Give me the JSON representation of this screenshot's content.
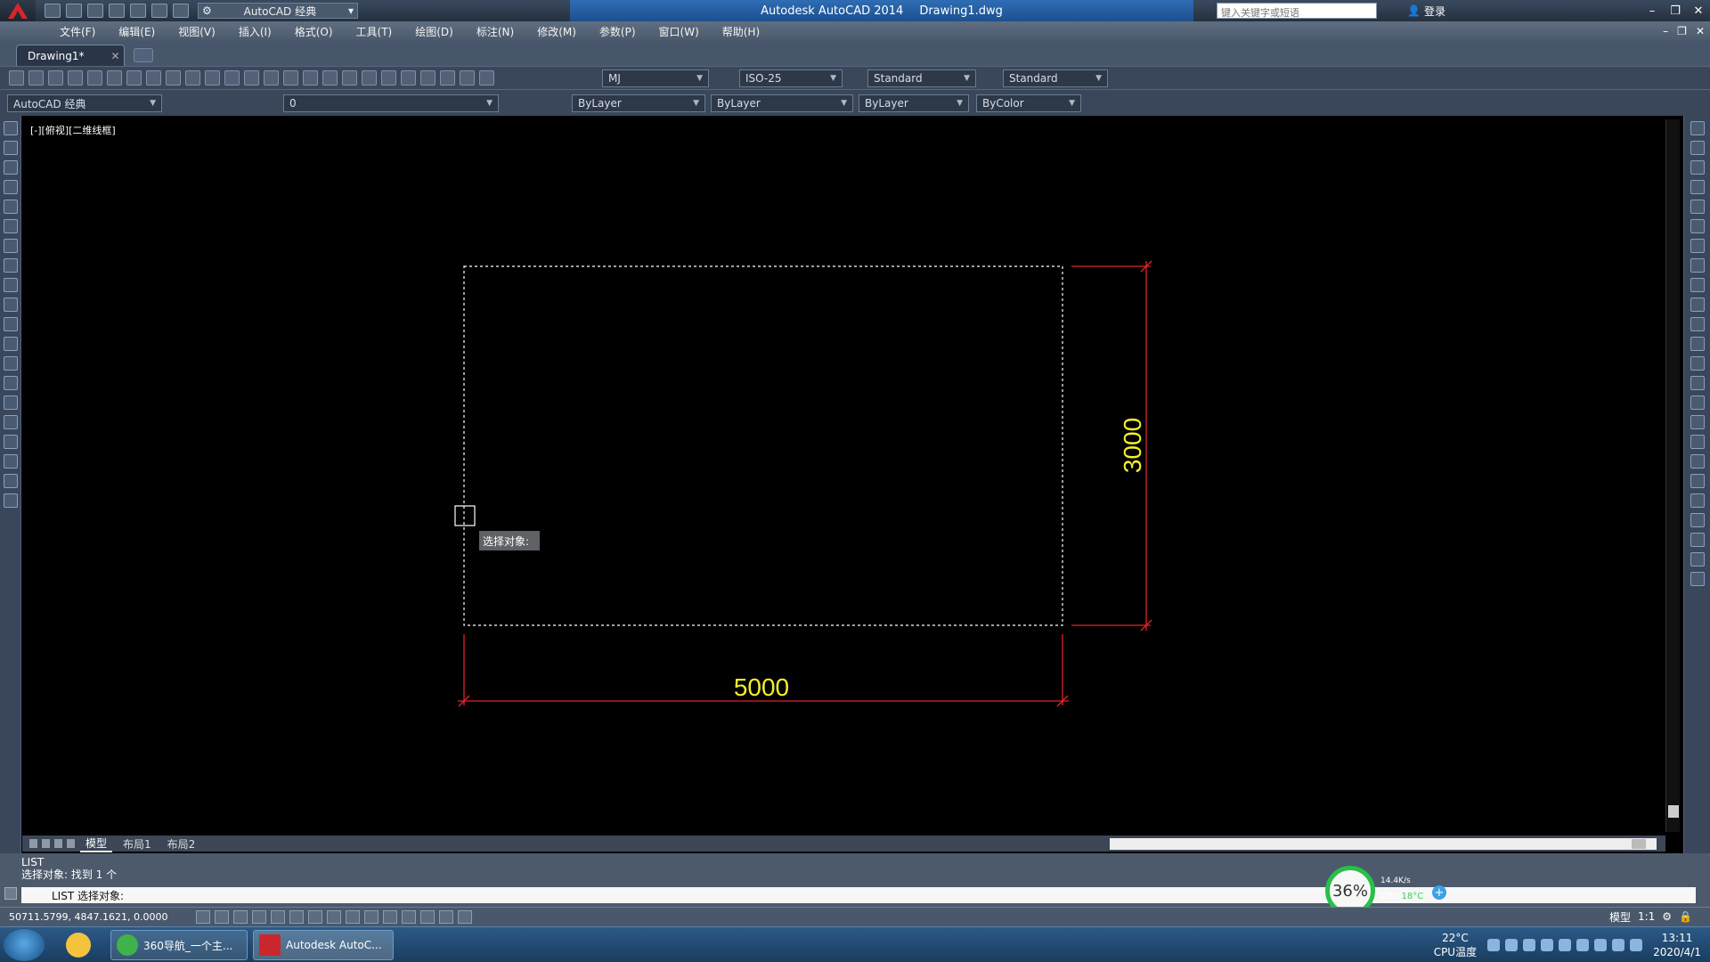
{
  "titlebar": {
    "workspace": "AutoCAD 经典",
    "app_title": "Autodesk AutoCAD 2014",
    "file_title": "Drawing1.dwg",
    "search_placeholder": "键入关键字或短语",
    "login_label": "登录"
  },
  "menubar": {
    "items": [
      "文件(F)",
      "编辑(E)",
      "视图(V)",
      "插入(I)",
      "格式(O)",
      "工具(T)",
      "绘图(D)",
      "标注(N)",
      "修改(M)",
      "参数(P)",
      "窗口(W)",
      "帮助(H)"
    ]
  },
  "tabs": {
    "document": "Drawing1*"
  },
  "toolbar": {
    "text_style": "MJ",
    "dim_style": "ISO-25",
    "table_style": "Standard",
    "multileader_style": "Standard",
    "workspace": "AutoCAD 经典",
    "layer": "0",
    "color": "ByLayer",
    "linetype": "ByLayer",
    "lineweight": "ByLayer",
    "plotstyle": "ByColor"
  },
  "viewport": {
    "label": "[-][俯视][二维线框]",
    "tooltip": "选择对象:"
  },
  "drawing": {
    "dim_horizontal": "5000",
    "dim_vertical": "3000",
    "colors": {
      "rectangle": "#ffffff",
      "dimension_line": "#e0242b",
      "dimension_text": "#f4f02a"
    }
  },
  "layout_tabs": [
    "模型",
    "布局1",
    "布局2"
  ],
  "command": {
    "history_1": "LIST",
    "history_2": "选择对象:  找到 1 个",
    "prompt": "LIST 选择对象:"
  },
  "status": {
    "coordinates": "50711.5799, 4847.1621, 0.0000",
    "model_label": "模型",
    "scale": "1:1"
  },
  "perf": {
    "cpu_percent": "36%",
    "net_speed": "14.4K/s",
    "cpu_temp_label": "CPU",
    "cpu_temp_value": "18°C"
  },
  "taskbar": {
    "task1": "360导航_一个主...",
    "task2": "Autodesk AutoC...",
    "weather_temp": "22°C",
    "weather_label": "CPU温度",
    "time": "13:11",
    "date": "2020/4/1"
  }
}
